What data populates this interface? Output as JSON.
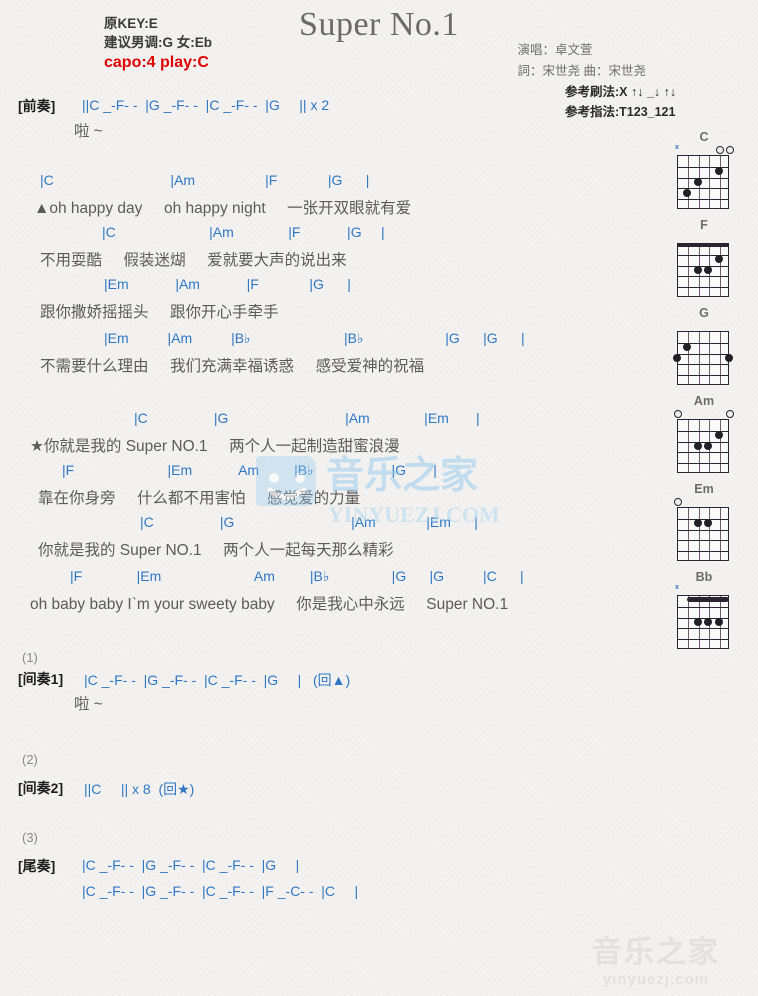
{
  "header": {
    "title": "Super No.1",
    "orig_key": "原KEY:E",
    "suggest_key": "建议男调:G 女:Eb",
    "capo": "capo:4 play:C",
    "singer": "演唱：卓文萱",
    "writer": "詞：宋世尧  曲：宋世尧",
    "strum_ref": "参考刷法:X ↑↓ _↓ ↑↓",
    "finger_ref": "参考指法:T123_121"
  },
  "intro": {
    "tag": "[前奏]",
    "chords": "||C _-F- -  |G _-F- -  |C _-F- -  |G     || x 2",
    "lyric": "啦 ~"
  },
  "verse": {
    "l1_chords": "|C                              |Am                  |F             |G      |",
    "l1_lyric": "▲oh happy day     oh happy night     一张开双眼就有爱",
    "l2_chords": "|C                        |Am              |F            |G     |",
    "l2_lyric": "不用耍酷     假装迷煳     爱就要大声的说出来",
    "l3_chords": "|Em            |Am            |F             |G      |",
    "l3_lyric": "跟你撒娇摇摇头     跟你开心手牵手",
    "l4_chords": "|Em          |Am          |B♭                        |B♭                     |G      |G      |",
    "l4_lyric": "不需要什么理由     我们充满幸福诱惑     感受爱神的祝福"
  },
  "chorus": {
    "l1_chords": "|C                 |G                              |Am              |Em       |",
    "l1_lyric": "★你就是我的 Super NO.1     两个人一起制造甜蜜浪漫",
    "l2_chords": "|F                        |Em            Am         |B♭                    |G       |",
    "l2_lyric": "靠在你身旁     什么都不用害怕     感觉爱的力量",
    "l3_chords": "|C                 |G                              |Am             |Em      |",
    "l3_lyric": "你就是我的 Super NO.1     两个人一起每天那么精彩",
    "l4_chords": "|F              |Em                        Am         |B♭                |G      |G          |C      |",
    "l4_lyric": "oh baby baby I`m your sweety baby     你是我心中永远     Super NO.1"
  },
  "interlude1": {
    "num": "(1)",
    "tag": "[间奏1]",
    "chords": "|C _-F- -  |G _-F- -  |C _-F- -  |G     |   (回▲)",
    "lyric": "啦 ~"
  },
  "interlude2": {
    "num": "(2)",
    "tag": "[间奏2]",
    "chords": "||C     || x 8  (回★)"
  },
  "outro": {
    "num": "(3)",
    "tag": "[尾奏]",
    "line1": "|C _-F- -  |G _-F- -  |C _-F- -  |G     |",
    "line2": "|C _-F- -  |G _-F- -  |C _-F- -  |F _-C- -  |C     |"
  },
  "chord_diagrams": [
    {
      "name": "C",
      "markers": [
        "x",
        "",
        "",
        "",
        "o",
        "o"
      ],
      "dots": [
        {
          "s": 1,
          "f": 3
        },
        {
          "s": 2,
          "f": 2
        },
        {
          "s": 4,
          "f": 1
        }
      ],
      "barre": null
    },
    {
      "name": "F",
      "markers": [
        "",
        "",
        "",
        "",
        "",
        ""
      ],
      "dots": [
        {
          "s": 2,
          "f": 2
        },
        {
          "s": 3,
          "f": 2
        },
        {
          "s": 4,
          "f": 1
        }
      ],
      "barre": {
        "f": 0,
        "from": 0,
        "to": 5
      }
    },
    {
      "name": "G",
      "markers": [
        "",
        "",
        "",
        "",
        "",
        ""
      ],
      "dots": [
        {
          "s": 0,
          "f": 2
        },
        {
          "s": 1,
          "f": 1
        },
        {
          "s": 5,
          "f": 2
        }
      ],
      "barre": null
    },
    {
      "name": "Am",
      "markers": [
        "o",
        "",
        "",
        "",
        "",
        "o"
      ],
      "dots": [
        {
          "s": 2,
          "f": 2
        },
        {
          "s": 3,
          "f": 2
        },
        {
          "s": 4,
          "f": 1
        }
      ],
      "barre": null
    },
    {
      "name": "Em",
      "markers": [
        "o",
        "",
        "",
        "",
        "",
        ""
      ],
      "dots": [
        {
          "s": 2,
          "f": 1
        },
        {
          "s": 3,
          "f": 1
        }
      ],
      "barre": null
    },
    {
      "name": "Bb",
      "markers": [
        "x",
        "",
        "",
        "",
        "",
        ""
      ],
      "dots": [
        {
          "s": 2,
          "f": 2
        },
        {
          "s": 3,
          "f": 2
        },
        {
          "s": 4,
          "f": 2
        }
      ],
      "barre": {
        "f": 0,
        "from": 1,
        "to": 5
      }
    }
  ],
  "watermarks": {
    "center_cn": "音乐之家",
    "center_en": "YINYUEZJ.COM",
    "bottom_cn": "音乐之家",
    "bottom_en": "yinyuezj.com"
  }
}
